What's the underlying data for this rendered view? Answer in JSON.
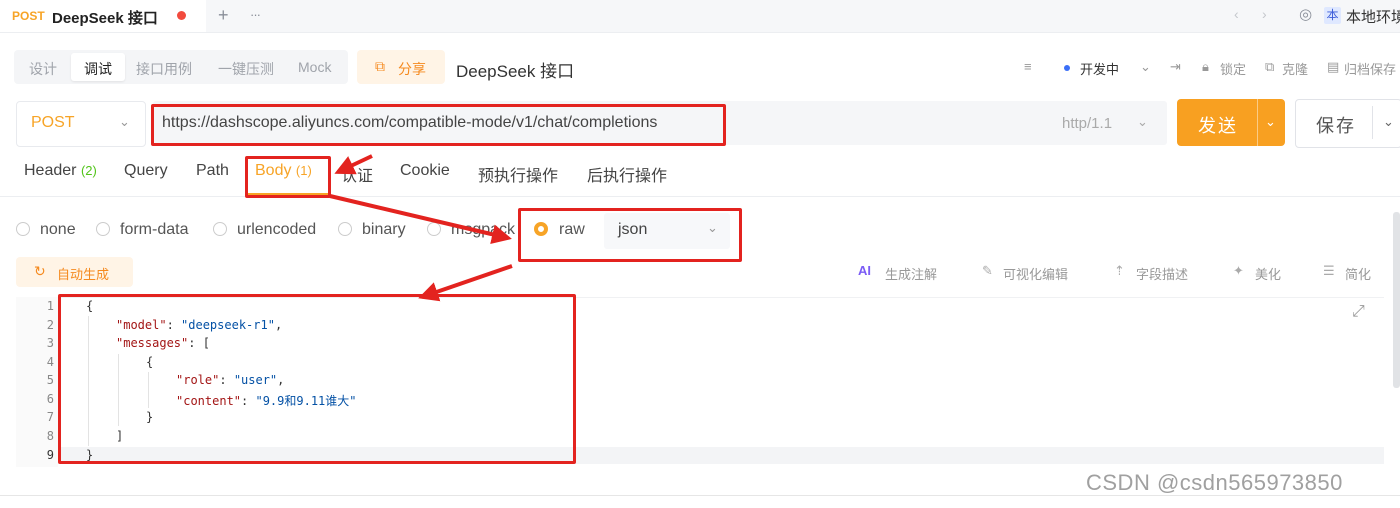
{
  "tab": {
    "method": "POST",
    "title": "DeepSeek 接口"
  },
  "toolbar_top": {
    "add": "+",
    "more": "···",
    "env_badge": "本",
    "env_name": "本地环境"
  },
  "modes": [
    "设计",
    "调试",
    "接口用例",
    "一键压测",
    "Mock"
  ],
  "share_label": "分享",
  "api_name": "DeepSeek 接口",
  "status": {
    "label": "开发中",
    "lock": "锁定",
    "clone": "克隆",
    "archive": "归档保存"
  },
  "request": {
    "method": "POST",
    "url": "https://dashscope.aliyuncs.com/compatible-mode/v1/chat/completions",
    "protocol": "http/1.1",
    "send_label": "发送",
    "save_label": "保存"
  },
  "param_tabs": [
    {
      "label": "Header",
      "count": "(2)"
    },
    {
      "label": "Query"
    },
    {
      "label": "Path"
    },
    {
      "label": "Body",
      "count": "(1)"
    },
    {
      "label": "认证"
    },
    {
      "label": "Cookie"
    },
    {
      "label": "预执行操作"
    },
    {
      "label": "后执行操作"
    }
  ],
  "body_types": [
    "none",
    "form-data",
    "urlencoded",
    "binary",
    "msgpack",
    "raw"
  ],
  "selected_body_type": "raw",
  "raw_format": "json",
  "auto_generate": "自动生成",
  "tools": [
    "生成注解",
    "可视化编辑",
    "字段描述",
    "美化",
    "简化"
  ],
  "code_lines": [
    {
      "n": "1",
      "text": "{"
    },
    {
      "n": "2",
      "key": "\"model\"",
      "val": "\"deepseek-r1\"",
      "tail": ","
    },
    {
      "n": "3",
      "key": "\"messages\"",
      "tail": ": ["
    },
    {
      "n": "4",
      "text": "{"
    },
    {
      "n": "5",
      "key": "\"role\"",
      "val": "\"user\"",
      "tail": ","
    },
    {
      "n": "6",
      "key": "\"content\"",
      "val": "\"9.9和9.11谁大\"",
      "tail": ""
    },
    {
      "n": "7",
      "text": "}"
    },
    {
      "n": "8",
      "text": "]"
    },
    {
      "n": "9",
      "text": "}"
    }
  ],
  "watermark": "CSDN @csdn565973850",
  "colors": {
    "accent": "#f7a427",
    "send": "#f8a021",
    "annotation": "#e3231f",
    "json_key": "#a31515",
    "json_string": "#0451a5"
  }
}
